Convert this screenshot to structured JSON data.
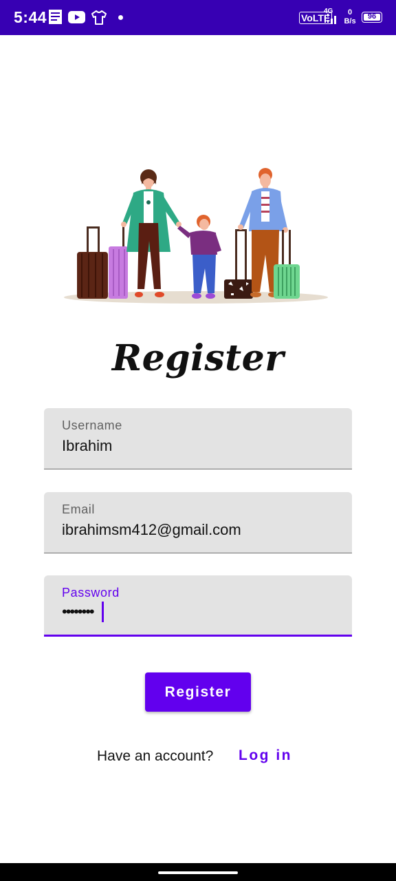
{
  "status_bar": {
    "time": "5:44",
    "network_label": "VoLTE",
    "network_type": "4G",
    "speed_value": "0",
    "speed_unit": "B/s",
    "battery_level": "96",
    "background_color": "#3700b3",
    "icons": [
      "notes-icon",
      "youtube-icon",
      "shirt-icon",
      "dot-icon",
      "signal-icon",
      "battery-icon"
    ]
  },
  "illustration": {
    "icon": "family-travel-illustration"
  },
  "title": "Register",
  "form": {
    "username": {
      "label": "Username",
      "value": "Ibrahim"
    },
    "email": {
      "label": "Email",
      "value": "ibrahimsm412@gmail.com"
    },
    "password": {
      "label": "Password",
      "value": "••••••••"
    }
  },
  "register_button": {
    "label": "Register"
  },
  "footer": {
    "prompt": "Have an account?",
    "login_label": "Log in"
  },
  "colors": {
    "accent": "#6200ee",
    "status_bar": "#3700b3",
    "field_background": "#e3e3e3"
  }
}
